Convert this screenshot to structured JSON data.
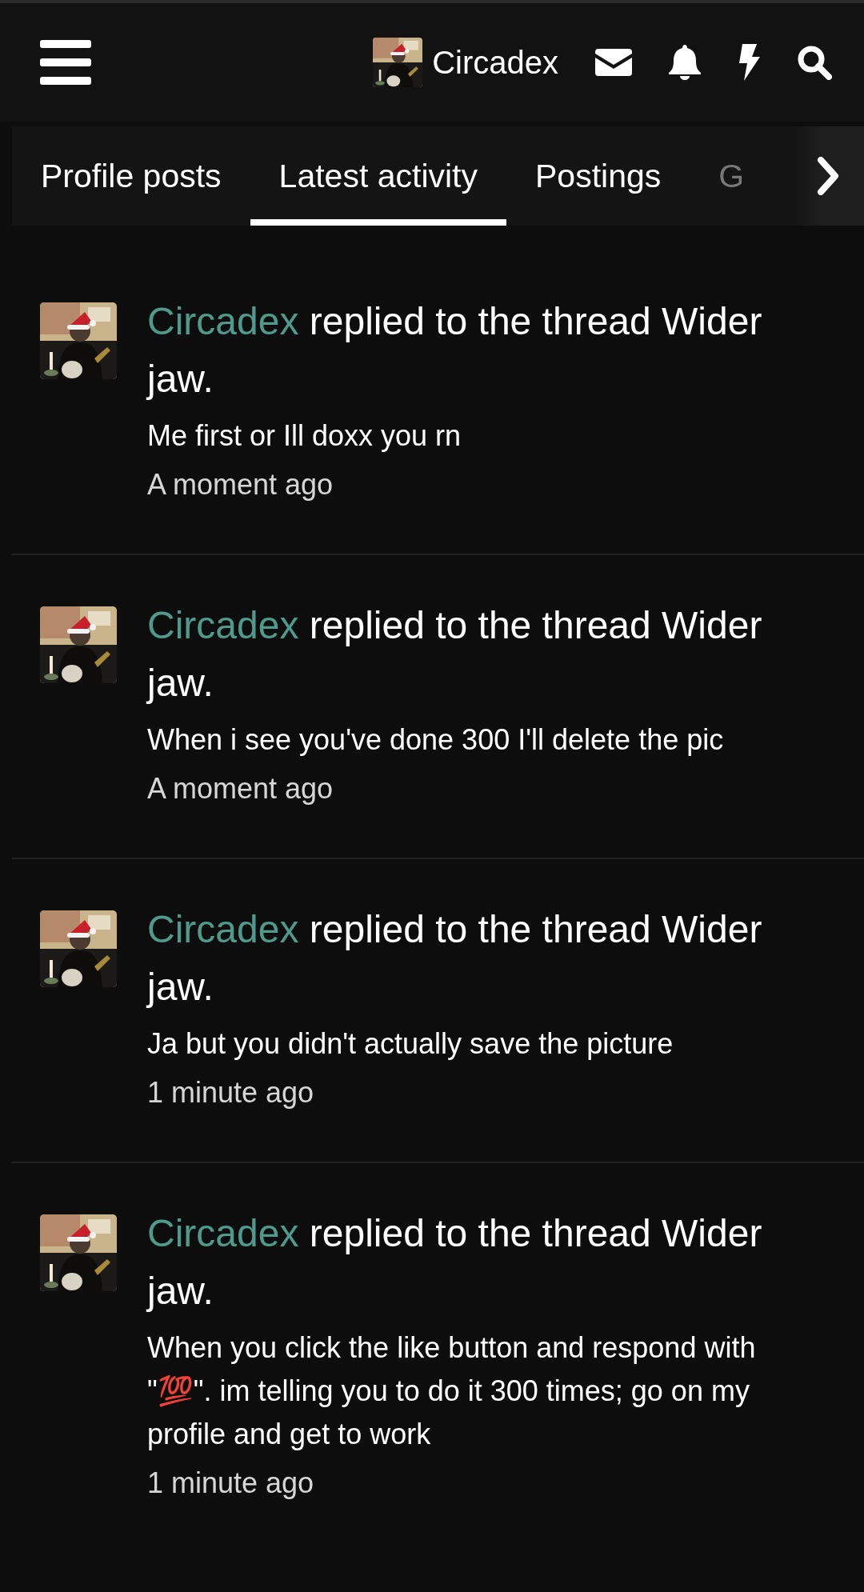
{
  "header": {
    "username": "Circadex"
  },
  "tabs": [
    {
      "label": "Profile posts",
      "selected": false
    },
    {
      "label": "Latest activity",
      "selected": true
    },
    {
      "label": "Postings",
      "selected": false
    },
    {
      "label": "G",
      "selected": false
    }
  ],
  "activity": [
    {
      "actor": "Circadex",
      "action": "replied to the thread Wider jaw.",
      "snippet": "Me first or Ill doxx you rn",
      "time": "A moment ago"
    },
    {
      "actor": "Circadex",
      "action": "replied to the thread Wider jaw.",
      "snippet": "When i see you've done 300 I'll delete the pic",
      "time": "A moment ago"
    },
    {
      "actor": "Circadex",
      "action": "replied to the thread Wider jaw.",
      "snippet": "Ja but you didn't actually save the picture",
      "time": "1 minute ago"
    },
    {
      "actor": "Circadex",
      "action": "replied to the thread Wider jaw.",
      "snippet": "When you click the like button and respond with \"💯\". im telling you to do it 300 times; go on my profile and get to work",
      "time": "1 minute ago"
    }
  ]
}
